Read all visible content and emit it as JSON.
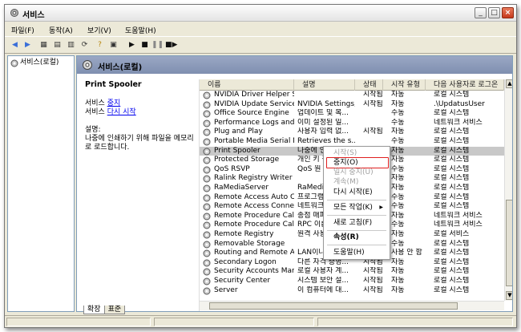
{
  "window": {
    "title": "서비스",
    "min": "_",
    "max": "□",
    "close": "×"
  },
  "menu": [
    "파일(F)",
    "동작(A)",
    "보기(V)",
    "도움말(H)"
  ],
  "tree": {
    "root_label": "서비스(로컬)"
  },
  "panel": {
    "header": "서비스(로컬)"
  },
  "detail": {
    "service_name": "Print Spooler",
    "service_prefix": "서비스 ",
    "stop_link": "중지",
    "restart_link": "다시 시작",
    "desc_label": "설명:",
    "desc_text": "나중에 인쇄하기 위해 파일을 메모리로 로드합니다."
  },
  "columns": [
    "이름",
    "설명",
    "상태",
    "시작 유형",
    "다음 사용자로 로그온"
  ],
  "rows": [
    {
      "name": "NVIDIA Driver Helper Ser...",
      "desc": "",
      "status": "시작됨",
      "startup": "자동",
      "logon": "로컬 시스템"
    },
    {
      "name": "NVIDIA Update Service D...",
      "desc": "NVIDIA Settings,...",
      "status": "시작됨",
      "startup": "자동",
      "logon": ".\\UpdatusUser"
    },
    {
      "name": "Office Source Engine",
      "desc": "업데이트 및 복...",
      "status": "",
      "startup": "수동",
      "logon": "로컬 시스템"
    },
    {
      "name": "Performance Logs and ...",
      "desc": "이미 설정된 일...",
      "status": "",
      "startup": "수동",
      "logon": "네트워크 서비스"
    },
    {
      "name": "Plug and Play",
      "desc": "사용자 입력 없...",
      "status": "시작됨",
      "startup": "자동",
      "logon": "로컬 시스템"
    },
    {
      "name": "Portable Media Serial N...",
      "desc": "Retrieves the s...",
      "status": "",
      "startup": "수동",
      "logon": "로컬 시스템"
    },
    {
      "name": "Print Spooler",
      "desc": "나중에 인쇄하기...",
      "status": "",
      "startup": "자동",
      "logon": "로컬 시스템",
      "selected": true
    },
    {
      "name": "Protected Storage",
      "desc": "개인 키 같은",
      "status": "",
      "startup": "자동",
      "logon": "로컬 시스템"
    },
    {
      "name": "QoS RSVP",
      "desc": "QoS 원 인식",
      "status": "",
      "startup": "수동",
      "logon": "로컬 시스템"
    },
    {
      "name": "Ralink Registry Writer",
      "desc": "",
      "status": "",
      "startup": "자동",
      "logon": "로컬 시스템"
    },
    {
      "name": "RaMediaServer",
      "desc": "RaMedia",
      "status": "",
      "startup": "자동",
      "logon": "로컬 시스템"
    },
    {
      "name": "Remote Access Auto Co...",
      "desc": "프로그램",
      "status": "",
      "startup": "수동",
      "logon": "로컬 시스템"
    },
    {
      "name": "Remote Access Connec...",
      "desc": "네트워크",
      "status": "",
      "startup": "수동",
      "logon": "로컬 시스템"
    },
    {
      "name": "Remote Procedure Call (...",
      "desc": "종점 매퍼",
      "status": "",
      "startup": "자동",
      "logon": "네트워크 서비스"
    },
    {
      "name": "Remote Procedure Call (...",
      "desc": "RPC 이름",
      "status": "",
      "startup": "수동",
      "logon": "네트워크 서비스"
    },
    {
      "name": "Remote Registry",
      "desc": "원격 사용",
      "status": "",
      "startup": "자동",
      "logon": "로컬 서비스"
    },
    {
      "name": "Removable Storage",
      "desc": "",
      "status": "",
      "startup": "수동",
      "logon": "로컬 시스템"
    },
    {
      "name": "Routing and Remote Acc...",
      "desc": "LAN이나",
      "status": "",
      "startup": "사용 안 함",
      "logon": "로컬 시스템"
    },
    {
      "name": "Secondary Logon",
      "desc": "다른 자격 증명...",
      "status": "시작됨",
      "startup": "자동",
      "logon": "로컬 시스템"
    },
    {
      "name": "Security Accounts Mana...",
      "desc": "로컬 사용자 계...",
      "status": "시작됨",
      "startup": "자동",
      "logon": "로컬 시스템"
    },
    {
      "name": "Security Center",
      "desc": "시스템 보안 설...",
      "status": "시작됨",
      "startup": "자동",
      "logon": "로컬 시스템"
    },
    {
      "name": "Server",
      "desc": "이 컴퓨터에 대...",
      "status": "시작됨",
      "startup": "자동",
      "logon": "로컬 시스템"
    }
  ],
  "context_menu": {
    "start": "시작(S)",
    "stop": "중지(O)",
    "pause": "일시 중지(U)",
    "resume": "계속(M)",
    "restart": "다시 시작(E)",
    "all_tasks": "모든 작업(K)",
    "refresh": "새로 고침(F)",
    "properties": "속성(R)",
    "help": "도움말(H)"
  },
  "tabs": {
    "extended": "확장",
    "standard": "표준"
  },
  "colors": {
    "header_bg": "#8a98b8",
    "highlight_border": "#e02020",
    "link": "#0000ee"
  }
}
